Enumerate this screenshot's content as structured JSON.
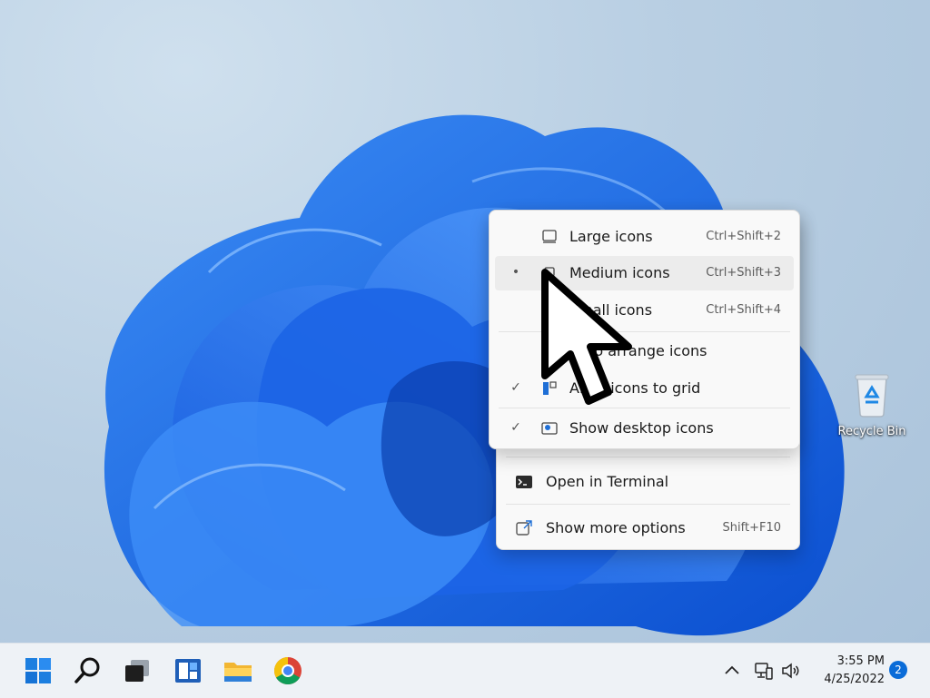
{
  "desktop": {
    "recycle_bin_label": "Recycle Bin"
  },
  "view_submenu": {
    "items": [
      {
        "label": "Large icons",
        "shortcut": "Ctrl+Shift+2",
        "mark": ""
      },
      {
        "label": "Medium icons",
        "shortcut": "Ctrl+Shift+3",
        "mark": "•"
      },
      {
        "label": "Small icons",
        "shortcut": "Ctrl+Shift+4",
        "mark": ""
      },
      {
        "label": "Auto arrange icons",
        "shortcut": "",
        "mark": ""
      },
      {
        "label": "Align icons to grid",
        "shortcut": "",
        "mark": "✓"
      },
      {
        "label": "Show desktop icons",
        "shortcut": "",
        "mark": "✓"
      }
    ]
  },
  "context_menu": {
    "open_terminal_label": "Open in Terminal",
    "show_more_label": "Show more options",
    "show_more_shortcut": "Shift+F10"
  },
  "taskbar": {
    "time": "3:55 PM",
    "date": "4/25/2022",
    "notification_count": "2",
    "icons": [
      "start-icon",
      "search-icon",
      "task-view-icon",
      "widgets-icon",
      "file-explorer-icon",
      "chrome-icon"
    ],
    "tray_icons": [
      "chevron-up-icon",
      "network-icon",
      "volume-icon"
    ]
  },
  "colors": {
    "accent": "#0a6cd8",
    "wallpaper_bloom": "#1f6fe8",
    "menu_background": "#f9f9f9"
  }
}
